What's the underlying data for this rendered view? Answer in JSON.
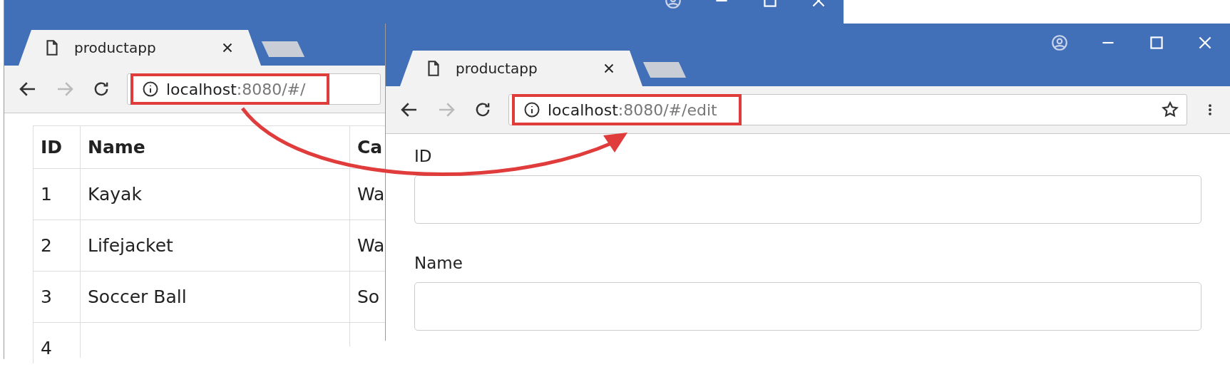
{
  "windows": [
    {
      "tab": {
        "title": "productapp"
      },
      "url": {
        "host": "localhost",
        "path": ":8080/#/"
      },
      "highlighted": true,
      "table": {
        "columns": [
          "ID",
          "Name",
          "Ca"
        ],
        "rows": [
          {
            "id": "1",
            "name": "Kayak",
            "category": "Wa"
          },
          {
            "id": "2",
            "name": "Lifejacket",
            "category": "Wa"
          },
          {
            "id": "3",
            "name": "Soccer Ball",
            "category": "So"
          },
          {
            "id": "4"
          }
        ]
      }
    },
    {
      "tab": {
        "title": "productapp"
      },
      "url": {
        "host": "localhost",
        "path": ":8080/#/edit"
      },
      "highlighted": true,
      "form": {
        "fields": [
          {
            "label": "ID"
          },
          {
            "label": "Name"
          }
        ]
      }
    }
  ]
}
